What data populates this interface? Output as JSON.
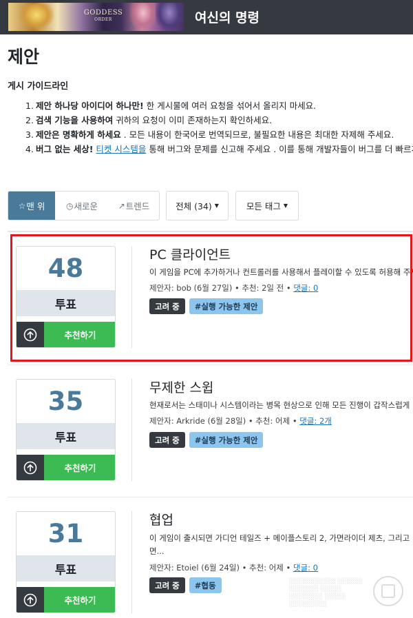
{
  "header": {
    "banner_logo_text": "GODDESS",
    "banner_logo_subtext": "ORDER",
    "site_title": "여신의 명령"
  },
  "page": {
    "title": "제안",
    "guidelines_heading": "게시 가이드라인"
  },
  "guidelines": [
    {
      "num": "1.",
      "bold": "제안 하나당 아이디어 하나만!",
      "text": " 한 게시물에 여러 요청을 섞어서 올리지 마세요.",
      "link": "",
      "after": ""
    },
    {
      "num": "2.",
      "bold": "검색 기능을 사용하여",
      "text": " 귀하의 요청이 이미 존재하는지 확인하세요.",
      "link": "",
      "after": ""
    },
    {
      "num": "3.",
      "bold": "제안은 명확하게 하세요",
      "text": " . 모든 내용이 한국어로 번역되므로, 불필요한 내용은 최대한 자제해 주세요.",
      "link": "",
      "after": ""
    },
    {
      "num": "4.",
      "bold": "버그 없는 세상!",
      "text": " ",
      "link": "티켓 시스템을",
      "after": " 통해 버그와 문제를 신고해 주세요 . 이를 통해 개발자들이 버그를 더 빠르게 해결할 수 있습니다."
    }
  ],
  "filters": {
    "tabs": [
      {
        "icon": "☆",
        "label": "맨 위"
      },
      {
        "icon": "◷",
        "label": "새로운"
      },
      {
        "icon": "↗",
        "label": "트렌드"
      }
    ],
    "category_dropdown": "전체 (34)",
    "tag_dropdown": "모든 태그"
  },
  "posts": [
    {
      "votes": "48",
      "vote_label": "투표",
      "upvote_label": "추천하기",
      "title": "PC 클라이언트",
      "description": "이 게임을 PC에 추가하거나 컨트롤러를 사용해서 플레이할 수 있도록 허용해 주세요.",
      "meta_prefix": "제안자: bob (6월 27일) • 추천: 2일 전 • ",
      "comments": "댓글: 0",
      "tags": [
        "고려 중",
        "#실행 가능한 제안"
      ]
    },
    {
      "votes": "35",
      "vote_label": "투표",
      "upvote_label": "추천하기",
      "title": "무제한 스윕",
      "description": "현재로서는 스태미나 시스템이라는 병목 현상으로 인해 모든 진행이 갑작스럽게 멈춥니다.",
      "meta_prefix": "제안자: Arkride (6월 28일) • 추천: 어제 • ",
      "comments": "댓글: 2개",
      "tags": [
        "고려 중",
        "#실행 가능한 제안"
      ]
    },
    {
      "votes": "31",
      "vote_label": "투표",
      "upvote_label": "추천하기",
      "title": "협업",
      "description": "이 게임이 출시되면 가디언 테일즈 + 메이플스토리 2, 가면라이더 제츠, 그리고 ...",
      "description_line2": "면...",
      "meta_prefix": "제안자: Etoiel (6월 24일) • 추천: 어제 • ",
      "comments": "댓글: 0",
      "tags": [
        "고려 중",
        "#협동"
      ]
    }
  ],
  "colors": {
    "topbar": "#343a40",
    "accent": "#4a7a99",
    "upvote_green": "#3cba54",
    "highlight_red": "#e3161b",
    "tag_blue": "#8cc5ee"
  }
}
